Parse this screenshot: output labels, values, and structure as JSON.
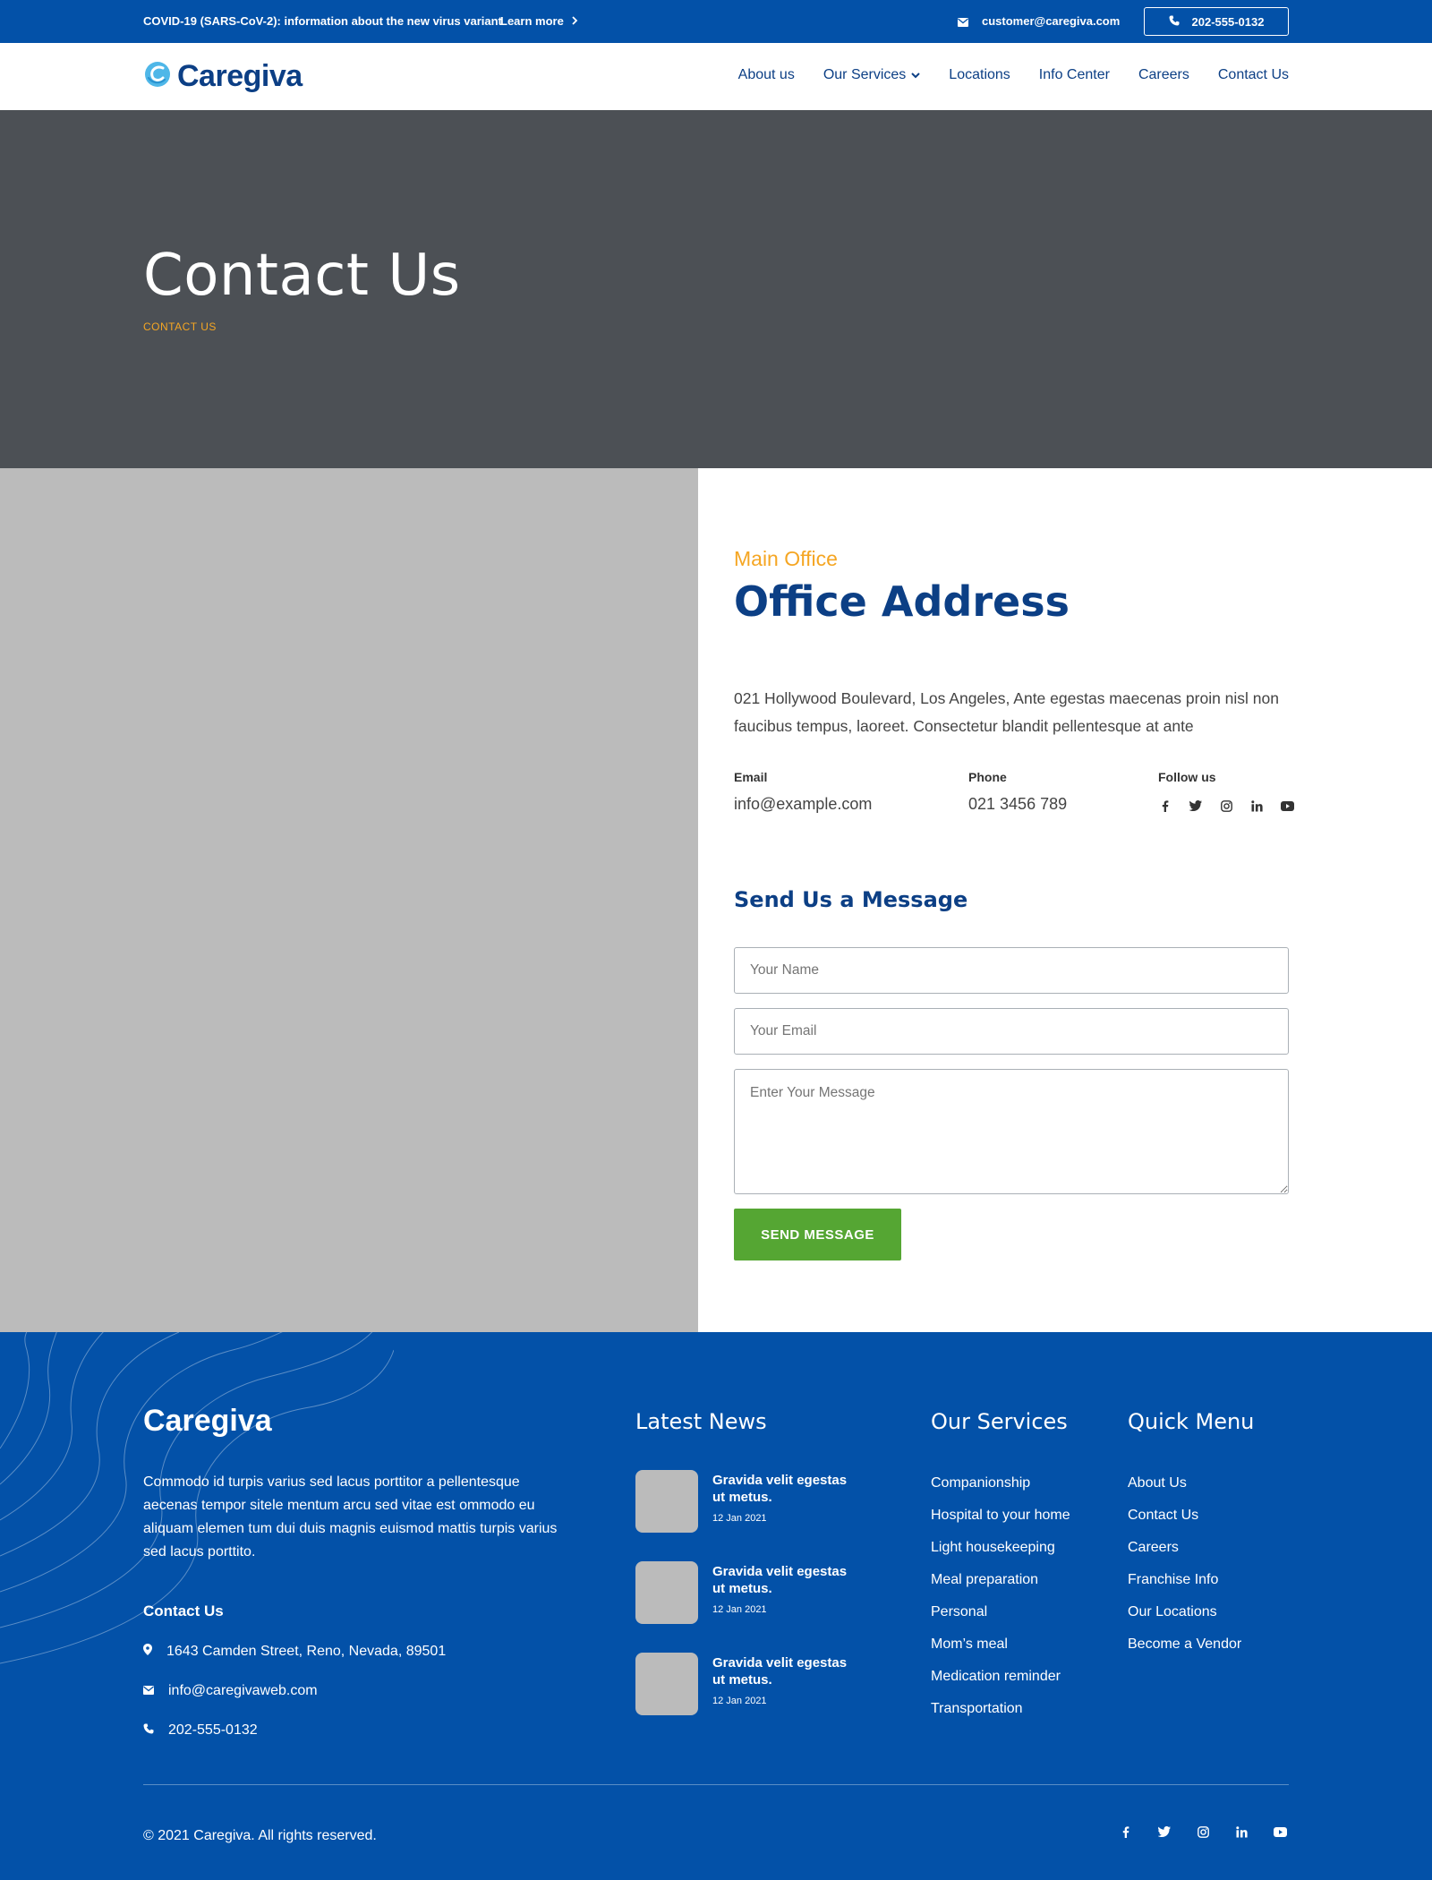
{
  "topbar": {
    "notice": "COVID-19 (SARS-CoV-2): information about the new virus variant",
    "learn_more": "Learn more",
    "email": "customer@caregiva.com",
    "phone": "202-555-0132"
  },
  "header": {
    "logo_text": "Caregiva",
    "nav": [
      "About us",
      "Our Services",
      "Locations",
      "Info Center",
      "Careers",
      "Contact Us"
    ]
  },
  "hero": {
    "title": "Contact Us",
    "breadcrumb": "CONTACT US"
  },
  "office": {
    "eyebrow": "Main Office",
    "title": "Office Address",
    "address": "021 Hollywood Boulevard, Los Angeles, Ante egestas maecenas proin nisl non faucibus tempus, laoreet. Consectetur blandit pellentesque at ante",
    "email_label": "Email",
    "email": "info@example.com",
    "phone_label": "Phone",
    "phone": "021 3456 789",
    "follow_label": "Follow us"
  },
  "form": {
    "title": "Send Us a Message",
    "name_placeholder": "Your Name",
    "email_placeholder": "Your Email",
    "message_placeholder": "Enter Your Message",
    "submit": "SEND MESSAGE"
  },
  "footer": {
    "brand": "Caregiva",
    "description": "Commodo id turpis varius sed lacus porttitor a pellentesque aecenas tempor sitele mentum arcu sed vitae est ommodo eu aliquam elemen tum dui duis magnis euismod mattis turpis varius sed lacus porttito.",
    "contact_heading": "Contact Us",
    "address": "1643  Camden Street, Reno, Nevada, 89501",
    "email": "info@caregivaweb.com",
    "phone": "202-555-0132",
    "news_heading": "Latest News",
    "news": [
      {
        "title": "Gravida velit egestas ut metus.",
        "date": "12 Jan 2021"
      },
      {
        "title": "Gravida velit egestas ut metus.",
        "date": "12 Jan 2021"
      },
      {
        "title": "Gravida velit egestas ut metus.",
        "date": "12 Jan 2021"
      }
    ],
    "services_heading": "Our Services",
    "services": [
      "Companionship",
      "Hospital to your home",
      "Light housekeeping",
      "Meal preparation",
      "Personal",
      "Mom’s meal",
      "Medication reminder",
      "Transportation"
    ],
    "quick_heading": "Quick Menu",
    "quick": [
      "About Us",
      "Contact Us",
      "Careers",
      "Franchise Info",
      "Our Locations",
      "Become a Vendor"
    ],
    "copyright": "© 2021 Caregiva. All rights reserved."
  },
  "colors": {
    "brand_blue": "#0351a8",
    "navy": "#0c3f85",
    "accent_orange": "#f5a623",
    "button_green": "#55a633",
    "hero_gray": "#4c5055",
    "placeholder_gray": "#bbbbbb"
  },
  "icons": [
    "envelope-icon",
    "phone-icon",
    "chevron-right-icon",
    "chevron-down-icon",
    "facebook-icon",
    "twitter-icon",
    "instagram-icon",
    "linkedin-icon",
    "youtube-icon",
    "map-pin-icon"
  ]
}
